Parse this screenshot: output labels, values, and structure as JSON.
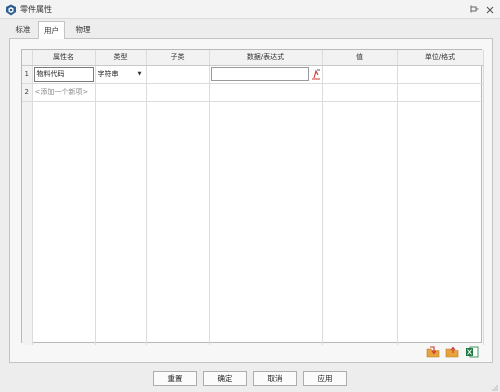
{
  "window": {
    "title": "零件属性"
  },
  "tabs": [
    {
      "label": "标准"
    },
    {
      "label": "用户"
    },
    {
      "label": "物理"
    }
  ],
  "active_tab": "用户",
  "table": {
    "headers": [
      "属性名",
      "类型",
      "子类",
      "数据/表达式",
      "值",
      "单位/格式"
    ],
    "rows": [
      {
        "num": "1",
        "name": "物料代码",
        "type": "字符串",
        "subtype": "",
        "expression": "",
        "value": "",
        "unit": ""
      },
      {
        "num": "2",
        "name": "<添加一个新项>",
        "type": "",
        "subtype": "",
        "expression": "",
        "value": "",
        "unit": ""
      }
    ]
  },
  "toolbar_icons": [
    "import-folder-icon",
    "export-folder-icon",
    "excel-icon"
  ],
  "buttons": {
    "reset": "重置",
    "ok": "确定",
    "cancel": "取消",
    "apply": "应用"
  },
  "colors": {
    "background": "#ededed",
    "panel": "#f7f7f7",
    "header_bg": "#f2f2f2",
    "fx_accent": "#d0342c",
    "excel_green": "#1e7a3c",
    "folder_orange": "#e8a33d"
  }
}
